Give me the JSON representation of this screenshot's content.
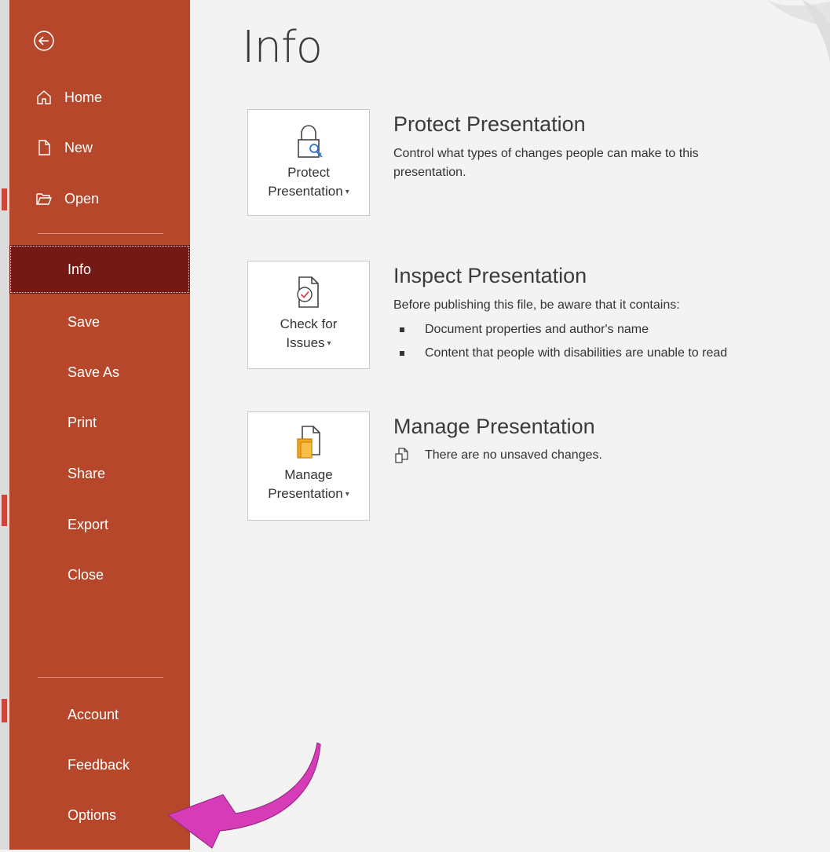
{
  "window": {
    "title": "Info"
  },
  "sidebar": {
    "back_icon": "back-arrow-circle-icon",
    "top_items": [
      {
        "label": "Home",
        "icon": "home-icon"
      },
      {
        "label": "New",
        "icon": "new-document-icon"
      },
      {
        "label": "Open",
        "icon": "open-folder-icon"
      }
    ],
    "items": [
      {
        "label": "Info",
        "active": true
      },
      {
        "label": "Save"
      },
      {
        "label": "Save As"
      },
      {
        "label": "Print"
      },
      {
        "label": "Share"
      },
      {
        "label": "Export"
      },
      {
        "label": "Close"
      }
    ],
    "bottom_items": [
      {
        "label": "Account"
      },
      {
        "label": "Feedback"
      },
      {
        "label": "Options"
      }
    ]
  },
  "sections": {
    "protect": {
      "tile_label_line1": "Protect",
      "tile_label_line2": "Presentation",
      "title": "Protect Presentation",
      "description": "Control what types of changes people can make to this presentation."
    },
    "inspect": {
      "tile_label_line1": "Check for",
      "tile_label_line2": "Issues",
      "title": "Inspect Presentation",
      "description": "Before publishing this file, be aware that it contains:",
      "bullets": [
        "Document properties and author's name",
        "Content that people with disabilities are unable to read"
      ]
    },
    "manage": {
      "tile_label_line1": "Manage",
      "tile_label_line2": "Presentation",
      "title": "Manage Presentation",
      "status": "There are no unsaved changes."
    }
  },
  "colors": {
    "sidebar_bg": "#b7472a",
    "sidebar_active": "#741913",
    "annotation_arrow": "#d63cb8"
  }
}
